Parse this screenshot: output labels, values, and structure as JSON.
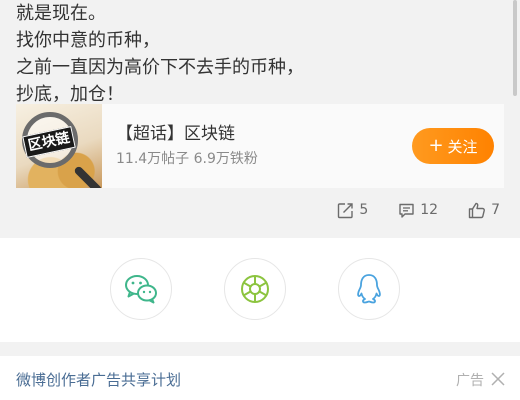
{
  "post": {
    "lines": [
      "就是现在。",
      "找你中意的币种，",
      "之前一直因为高价下不去手的币种，",
      "抄底，加仓！"
    ]
  },
  "topic_card": {
    "thumb_label": "区块链",
    "title": "【超话】区块链",
    "stats": "11.4万帖子 6.9万铁粉",
    "follow_label": "关注",
    "follow_icon": "plus-icon",
    "accent_color": "#ff8a00"
  },
  "actions": {
    "repost_count": "5",
    "comment_count": "12",
    "like_count": "7"
  },
  "share": {
    "items": [
      {
        "icon": "wechat-icon",
        "color": "#3fb68b"
      },
      {
        "icon": "moments-icon",
        "color": "#8cc43f"
      },
      {
        "icon": "qq-icon",
        "color": "#4aa3df"
      }
    ]
  },
  "footer": {
    "link_text": "微博创作者广告共享计划",
    "ad_label": "广告",
    "link_color": "#4a6d94"
  }
}
